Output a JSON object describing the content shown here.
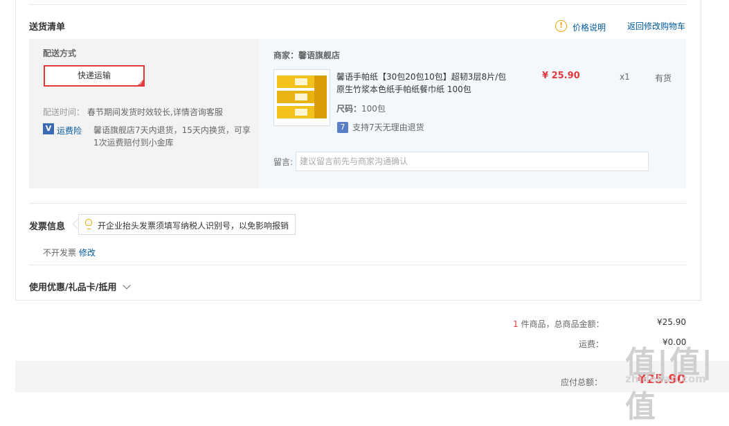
{
  "delivery": {
    "section_title": "送货清单",
    "price_note": "价格说明",
    "back_to_cart": "返回修改购物车",
    "shipping_method_label": "配送方式",
    "shipping_option": "快递运输",
    "delivery_time_label": "配送时间：",
    "delivery_time_value": "春节期间发货时效较长,详情咨询客服",
    "insurance_label": "运费险",
    "insurance_text_line1": "馨语旗舰店7天内退货，15天内换货，可享",
    "insurance_text_line2": "1次运费赔付到小金库"
  },
  "merchant": {
    "label": "商家：",
    "name": "馨语旗舰店"
  },
  "product": {
    "title_line1": "馨语手帕纸【30包20包10包】超韧3层8片/包",
    "title_line2": "原生竹浆本色纸手帕纸餐巾纸 100包",
    "price": "¥ 25.90",
    "quantity": "x1",
    "stock": "有货",
    "size_label": "尺码：",
    "size_value": "100包",
    "return_badge": "7",
    "return_policy": "支持7天无理由退货"
  },
  "remark": {
    "label": "留言:",
    "placeholder": "建议留言前先与商家沟通确认"
  },
  "invoice": {
    "title": "发票信息",
    "tip": "开企业抬头发票须填写纳税人识别号，以免影响报销",
    "status": "不开发票",
    "edit": "修改"
  },
  "coupon": {
    "title": "使用优惠/礼品卡/抵用"
  },
  "summary": {
    "item_count": "1",
    "item_count_text": "件商品，总商品金额：",
    "item_total": "¥25.90",
    "shipping_label": "运费：",
    "shipping_value": "¥0.00",
    "payable_label": "应付总额：",
    "payable_value": "¥25.90"
  },
  "watermark": {
    "logo": "值|值|值",
    "site": "zhidekan.com"
  },
  "colors": {
    "accent_red": "#e4393c",
    "link_blue": "#005aa0",
    "warning_orange": "#f0a30a"
  }
}
